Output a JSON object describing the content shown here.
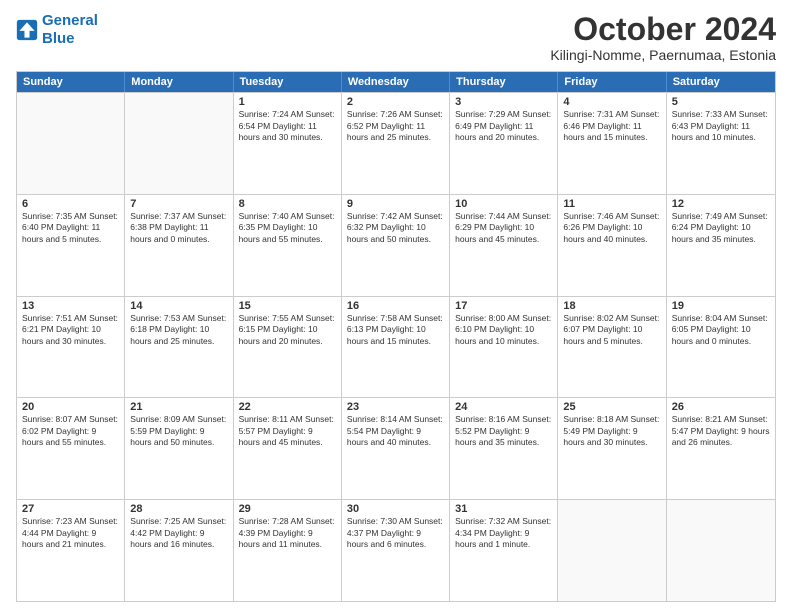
{
  "logo": {
    "line1": "General",
    "line2": "Blue"
  },
  "title": "October 2024",
  "subtitle": "Kilingi-Nomme, Paernumaa, Estonia",
  "headers": [
    "Sunday",
    "Monday",
    "Tuesday",
    "Wednesday",
    "Thursday",
    "Friday",
    "Saturday"
  ],
  "weeks": [
    [
      {
        "day": "",
        "info": ""
      },
      {
        "day": "",
        "info": ""
      },
      {
        "day": "1",
        "info": "Sunrise: 7:24 AM\nSunset: 6:54 PM\nDaylight: 11 hours\nand 30 minutes."
      },
      {
        "day": "2",
        "info": "Sunrise: 7:26 AM\nSunset: 6:52 PM\nDaylight: 11 hours\nand 25 minutes."
      },
      {
        "day": "3",
        "info": "Sunrise: 7:29 AM\nSunset: 6:49 PM\nDaylight: 11 hours\nand 20 minutes."
      },
      {
        "day": "4",
        "info": "Sunrise: 7:31 AM\nSunset: 6:46 PM\nDaylight: 11 hours\nand 15 minutes."
      },
      {
        "day": "5",
        "info": "Sunrise: 7:33 AM\nSunset: 6:43 PM\nDaylight: 11 hours\nand 10 minutes."
      }
    ],
    [
      {
        "day": "6",
        "info": "Sunrise: 7:35 AM\nSunset: 6:40 PM\nDaylight: 11 hours\nand 5 minutes."
      },
      {
        "day": "7",
        "info": "Sunrise: 7:37 AM\nSunset: 6:38 PM\nDaylight: 11 hours\nand 0 minutes."
      },
      {
        "day": "8",
        "info": "Sunrise: 7:40 AM\nSunset: 6:35 PM\nDaylight: 10 hours\nand 55 minutes."
      },
      {
        "day": "9",
        "info": "Sunrise: 7:42 AM\nSunset: 6:32 PM\nDaylight: 10 hours\nand 50 minutes."
      },
      {
        "day": "10",
        "info": "Sunrise: 7:44 AM\nSunset: 6:29 PM\nDaylight: 10 hours\nand 45 minutes."
      },
      {
        "day": "11",
        "info": "Sunrise: 7:46 AM\nSunset: 6:26 PM\nDaylight: 10 hours\nand 40 minutes."
      },
      {
        "day": "12",
        "info": "Sunrise: 7:49 AM\nSunset: 6:24 PM\nDaylight: 10 hours\nand 35 minutes."
      }
    ],
    [
      {
        "day": "13",
        "info": "Sunrise: 7:51 AM\nSunset: 6:21 PM\nDaylight: 10 hours\nand 30 minutes."
      },
      {
        "day": "14",
        "info": "Sunrise: 7:53 AM\nSunset: 6:18 PM\nDaylight: 10 hours\nand 25 minutes."
      },
      {
        "day": "15",
        "info": "Sunrise: 7:55 AM\nSunset: 6:15 PM\nDaylight: 10 hours\nand 20 minutes."
      },
      {
        "day": "16",
        "info": "Sunrise: 7:58 AM\nSunset: 6:13 PM\nDaylight: 10 hours\nand 15 minutes."
      },
      {
        "day": "17",
        "info": "Sunrise: 8:00 AM\nSunset: 6:10 PM\nDaylight: 10 hours\nand 10 minutes."
      },
      {
        "day": "18",
        "info": "Sunrise: 8:02 AM\nSunset: 6:07 PM\nDaylight: 10 hours\nand 5 minutes."
      },
      {
        "day": "19",
        "info": "Sunrise: 8:04 AM\nSunset: 6:05 PM\nDaylight: 10 hours\nand 0 minutes."
      }
    ],
    [
      {
        "day": "20",
        "info": "Sunrise: 8:07 AM\nSunset: 6:02 PM\nDaylight: 9 hours\nand 55 minutes."
      },
      {
        "day": "21",
        "info": "Sunrise: 8:09 AM\nSunset: 5:59 PM\nDaylight: 9 hours\nand 50 minutes."
      },
      {
        "day": "22",
        "info": "Sunrise: 8:11 AM\nSunset: 5:57 PM\nDaylight: 9 hours\nand 45 minutes."
      },
      {
        "day": "23",
        "info": "Sunrise: 8:14 AM\nSunset: 5:54 PM\nDaylight: 9 hours\nand 40 minutes."
      },
      {
        "day": "24",
        "info": "Sunrise: 8:16 AM\nSunset: 5:52 PM\nDaylight: 9 hours\nand 35 minutes."
      },
      {
        "day": "25",
        "info": "Sunrise: 8:18 AM\nSunset: 5:49 PM\nDaylight: 9 hours\nand 30 minutes."
      },
      {
        "day": "26",
        "info": "Sunrise: 8:21 AM\nSunset: 5:47 PM\nDaylight: 9 hours\nand 26 minutes."
      }
    ],
    [
      {
        "day": "27",
        "info": "Sunrise: 7:23 AM\nSunset: 4:44 PM\nDaylight: 9 hours\nand 21 minutes."
      },
      {
        "day": "28",
        "info": "Sunrise: 7:25 AM\nSunset: 4:42 PM\nDaylight: 9 hours\nand 16 minutes."
      },
      {
        "day": "29",
        "info": "Sunrise: 7:28 AM\nSunset: 4:39 PM\nDaylight: 9 hours\nand 11 minutes."
      },
      {
        "day": "30",
        "info": "Sunrise: 7:30 AM\nSunset: 4:37 PM\nDaylight: 9 hours\nand 6 minutes."
      },
      {
        "day": "31",
        "info": "Sunrise: 7:32 AM\nSunset: 4:34 PM\nDaylight: 9 hours\nand 1 minute."
      },
      {
        "day": "",
        "info": ""
      },
      {
        "day": "",
        "info": ""
      }
    ]
  ]
}
